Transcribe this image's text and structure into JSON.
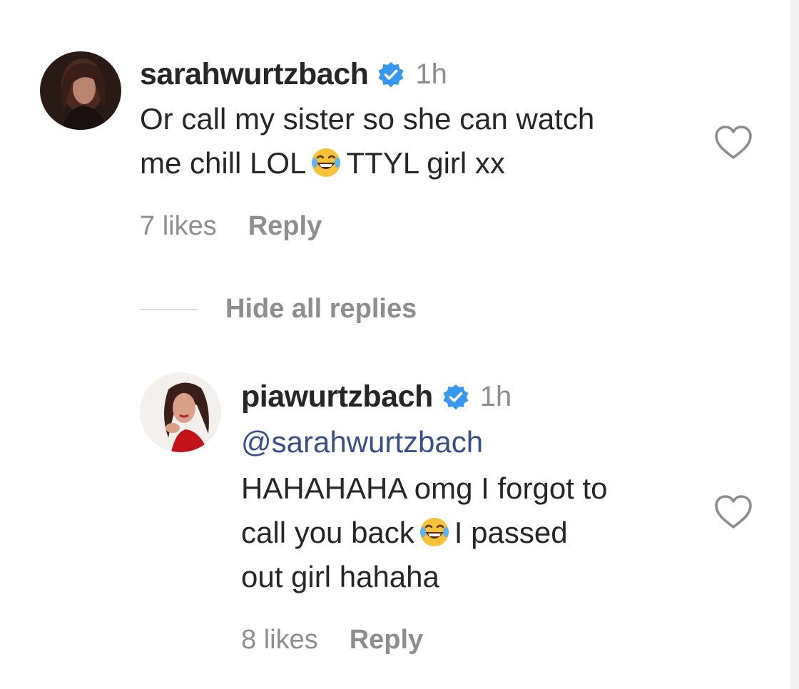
{
  "comment": {
    "username": "sarahwurtzbach",
    "time": "1h",
    "text_line1": "Or call my sister so she can watch",
    "text_line2_before": "me chill LOL",
    "text_line2_after": "TTYL girl xx",
    "emoji_icon": "face-with-tears-of-joy-icon",
    "likes": "7 likes",
    "reply_label": "Reply"
  },
  "replies_toggle": {
    "label": "Hide all replies"
  },
  "reply": {
    "username": "piawurtzbach",
    "time": "1h",
    "mention": "@sarahwurtzbach",
    "text_line1": "HAHAHAHA omg I forgot to",
    "text_line2_before": "call you back",
    "text_line2_after": "I passed",
    "text_line3": "out girl hahaha",
    "emoji_icon": "face-with-tears-of-joy-icon",
    "likes": "8 likes",
    "reply_label": "Reply"
  },
  "colors": {
    "verified_badge": "#3897f0",
    "secondary_text": "#8e8e8e",
    "mention_text": "#3a4f8a",
    "primary_text": "#262626"
  }
}
